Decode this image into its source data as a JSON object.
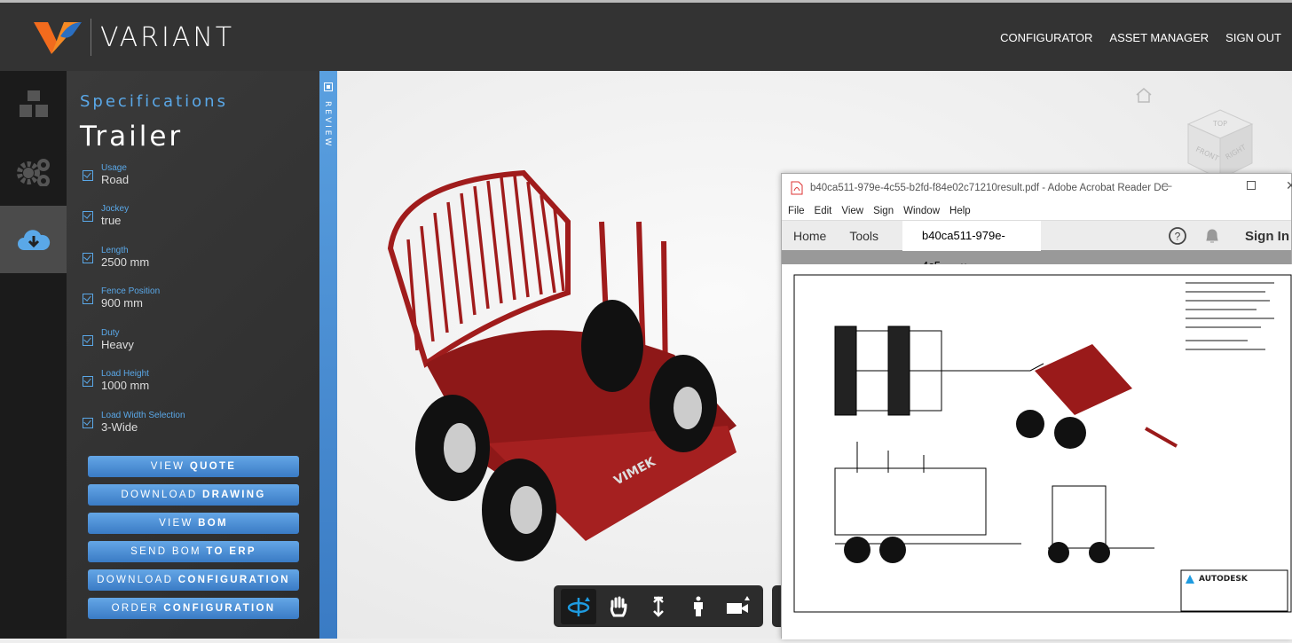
{
  "header": {
    "brand": "VARIANT",
    "nav": [
      "CONFIGURATOR",
      "ASSET MANAGER",
      "SIGN OUT"
    ]
  },
  "rail": {
    "items": [
      {
        "icon": "boxes-icon"
      },
      {
        "icon": "gears-icon"
      },
      {
        "icon": "cloud-download-icon",
        "selected": true
      }
    ]
  },
  "spec": {
    "subtitle": "Specifications",
    "title": "Trailer",
    "options": [
      {
        "label": "Usage",
        "value": "Road"
      },
      {
        "label": "Jockey",
        "value": "true"
      },
      {
        "label": "Length",
        "value": "2500 mm"
      },
      {
        "label": "Fence Position",
        "value": "900 mm"
      },
      {
        "label": "Duty",
        "value": "Heavy"
      },
      {
        "label": "Load Height",
        "value": "1000 mm"
      },
      {
        "label": "Load Width Selection",
        "value": "3-Wide"
      }
    ],
    "buttons": [
      {
        "light": "VIEW ",
        "bold": "QUOTE"
      },
      {
        "light": "DOWNLOAD ",
        "bold": "DRAWING"
      },
      {
        "light": "VIEW ",
        "bold": "BOM"
      },
      {
        "light": "SEND BOM ",
        "bold": "TO ERP"
      },
      {
        "light": "DOWNLOAD ",
        "bold": "CONFIGURATION"
      },
      {
        "light": "ORDER ",
        "bold": "CONFIGURATION"
      }
    ]
  },
  "review": {
    "label": "REVIEW"
  },
  "viewer": {
    "brand_on_model": "VIMEK",
    "cube": {
      "top": "TOP",
      "front": "FRONT",
      "right": "RIGHT"
    },
    "tools": [
      "orbit-icon",
      "pan-icon",
      "zoom-icon",
      "walk-icon",
      "camera-icon"
    ],
    "accent": "#1e9be0"
  },
  "acrobat": {
    "title": "b40ca511-979e-4c55-b2fd-f84e02c71210result.pdf - Adobe Acrobat Reader DC",
    "menu": [
      "File",
      "Edit",
      "View",
      "Sign",
      "Window",
      "Help"
    ],
    "tabs": {
      "home": "Home",
      "tools": "Tools",
      "doc": "b40ca511-979e-4c5...",
      "close": "×"
    },
    "sign_in": "Sign In",
    "titleblock": {
      "brand": "AUTODESK"
    }
  },
  "colors": {
    "accent": "#5aa8e8",
    "model_red": "#a01c1c"
  }
}
